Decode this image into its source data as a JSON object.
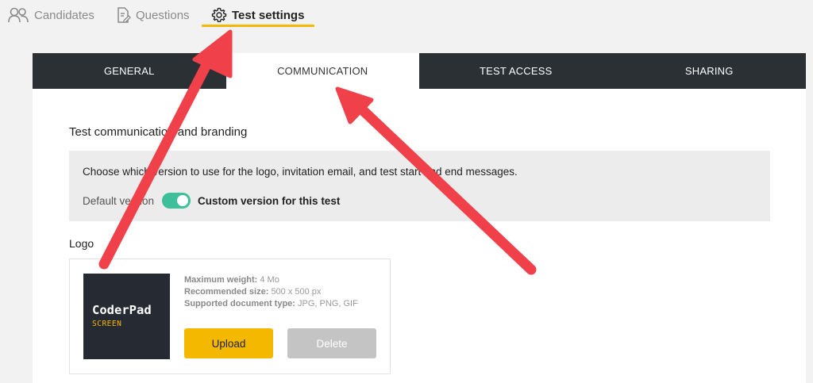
{
  "nav": {
    "items": [
      {
        "label": "Candidates",
        "icon": "users-icon"
      },
      {
        "label": "Questions",
        "icon": "document-edit-icon"
      },
      {
        "label": "Test settings",
        "icon": "gear-icon"
      }
    ],
    "active_accent": "#f5b800"
  },
  "tabs": [
    "GENERAL",
    "COMMUNICATION",
    "TEST ACCESS",
    "SHARING"
  ],
  "active_tab": "COMMUNICATION",
  "section": {
    "title": "Test communication and branding",
    "info": "Choose which version to use for the logo, invitation email, and test start and end messages.",
    "toggle": {
      "left_label": "Default version",
      "right_label": "Custom version for this test",
      "state": "on",
      "color": "#3dbf9a"
    }
  },
  "logo": {
    "title": "Logo",
    "preview": {
      "name": "CoderPad",
      "sub": "SCREEN"
    },
    "specs": {
      "weight_label": "Maximum weight:",
      "weight_value": "4 Mo",
      "size_label": "Recommended size:",
      "size_value": "500 x 500 px",
      "type_label": "Supported document type:",
      "type_value": "JPG, PNG, GIF"
    },
    "upload_label": "Upload",
    "delete_label": "Delete"
  },
  "annotations": {
    "arrow_color": "#f0414a"
  }
}
